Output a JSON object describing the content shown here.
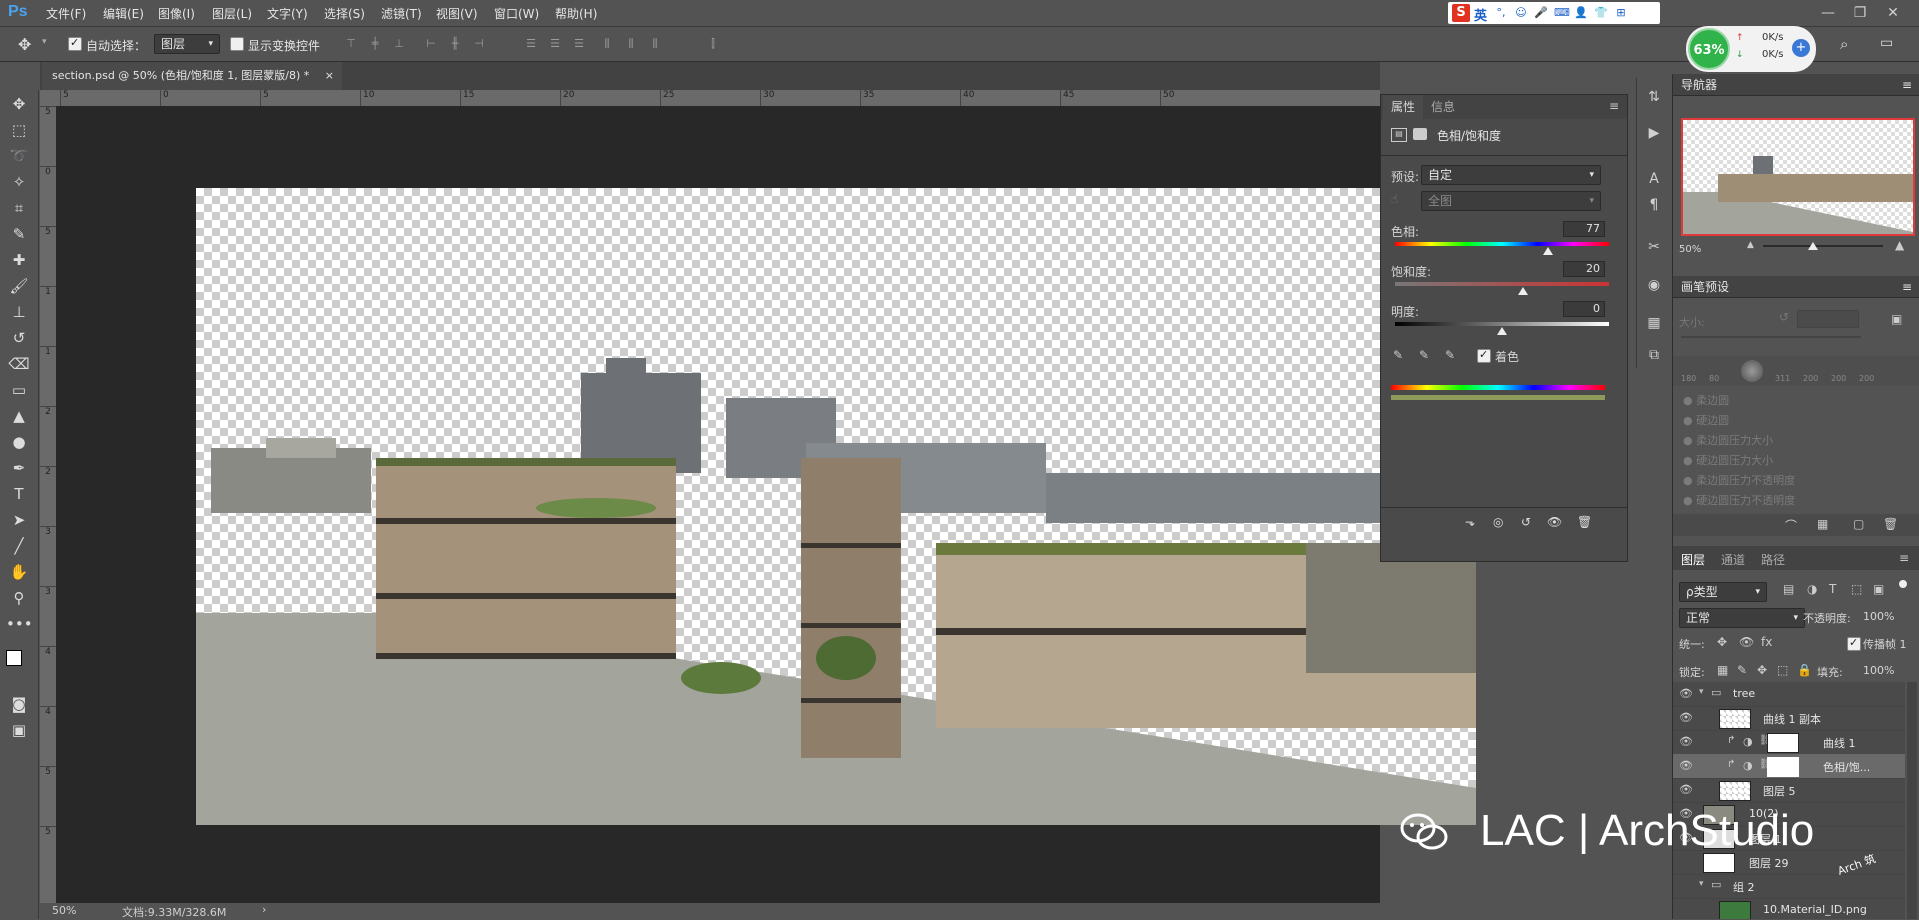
{
  "app": {
    "logo": "Ps"
  },
  "menu": [
    "文件(F)",
    "编辑(E)",
    "图像(I)",
    "图层(L)",
    "文字(Y)",
    "选择(S)",
    "滤镜(T)",
    "视图(V)",
    "窗口(W)",
    "帮助(H)"
  ],
  "ime": {
    "label": "英",
    "logo": "S"
  },
  "options": {
    "auto_select_label": "自动选择：",
    "auto_select_value": "图层",
    "show_transform_label": "显示变换控件"
  },
  "network": {
    "percent": "63%",
    "up": "0K/s",
    "down": "0K/s"
  },
  "document_tab": {
    "title": "section.psd @ 50% (色相/饱和度 1, 图层蒙版/8) *"
  },
  "ruler": {
    "h_ticks": [
      "5",
      "0",
      "5",
      "10",
      "15",
      "20",
      "25",
      "30",
      "35",
      "40",
      "45",
      "50"
    ],
    "v_ticks": [
      "5",
      "0",
      "5",
      "1",
      "1",
      "2",
      "2",
      "3",
      "3",
      "4",
      "4",
      "5",
      "5"
    ]
  },
  "status": {
    "zoom": "50%",
    "doc_size": "文档:9.33M/328.6M"
  },
  "properties": {
    "tab1": "属性",
    "tab2": "信息",
    "adjustment_name": "色相/饱和度",
    "preset_label": "预设:",
    "preset_value": "自定",
    "channel_value": "全图",
    "hue_label": "色相:",
    "hue_value": "77",
    "hue": 77,
    "saturation_label": "饱和度:",
    "saturation_value": "20",
    "saturation": 20,
    "lightness_label": "明度:",
    "lightness_value": "0",
    "lightness": 0,
    "colorize_label": "着色"
  },
  "navigator": {
    "title": "导航器",
    "zoom": "50%"
  },
  "brush_presets": {
    "title": "画笔预设",
    "size_label": "大小:",
    "sizes": [
      "180",
      "80",
      "",
      "311",
      "200",
      "200",
      "200"
    ],
    "items": [
      "柔边圆",
      "硬边圆",
      "柔边圆压力大小",
      "硬边圆压力大小",
      "柔边圆压力不透明度",
      "硬边圆压力不透明度"
    ]
  },
  "layers": {
    "tabs": [
      "图层",
      "通道",
      "路径"
    ],
    "filter_label": "ρ类型",
    "blend_mode": "正常",
    "opacity_label": "不透明度:",
    "opacity_value": "100%",
    "unify_label": "统一:",
    "propagate_label": "传播帧 1",
    "lock_label": "锁定:",
    "fill_label": "填充:",
    "fill_value": "100%",
    "rows": [
      {
        "name": "tree"
      },
      {
        "name": "曲线 1 副本"
      },
      {
        "name": "曲线 1"
      },
      {
        "name": "色相/饱..."
      },
      {
        "name": "图层 5"
      },
      {
        "name": "10(2)"
      },
      {
        "name": "图层 1"
      },
      {
        "name": "图层 29"
      },
      {
        "name": "组 2"
      },
      {
        "name": "10.Material_ID.png"
      }
    ]
  },
  "watermark": {
    "text": "LAC | ArchStudio",
    "badge": "Arch 筑"
  },
  "colors": {
    "accent": "#4aa3f0",
    "nav_border": "#e03a3a",
    "bg": "#535353"
  }
}
